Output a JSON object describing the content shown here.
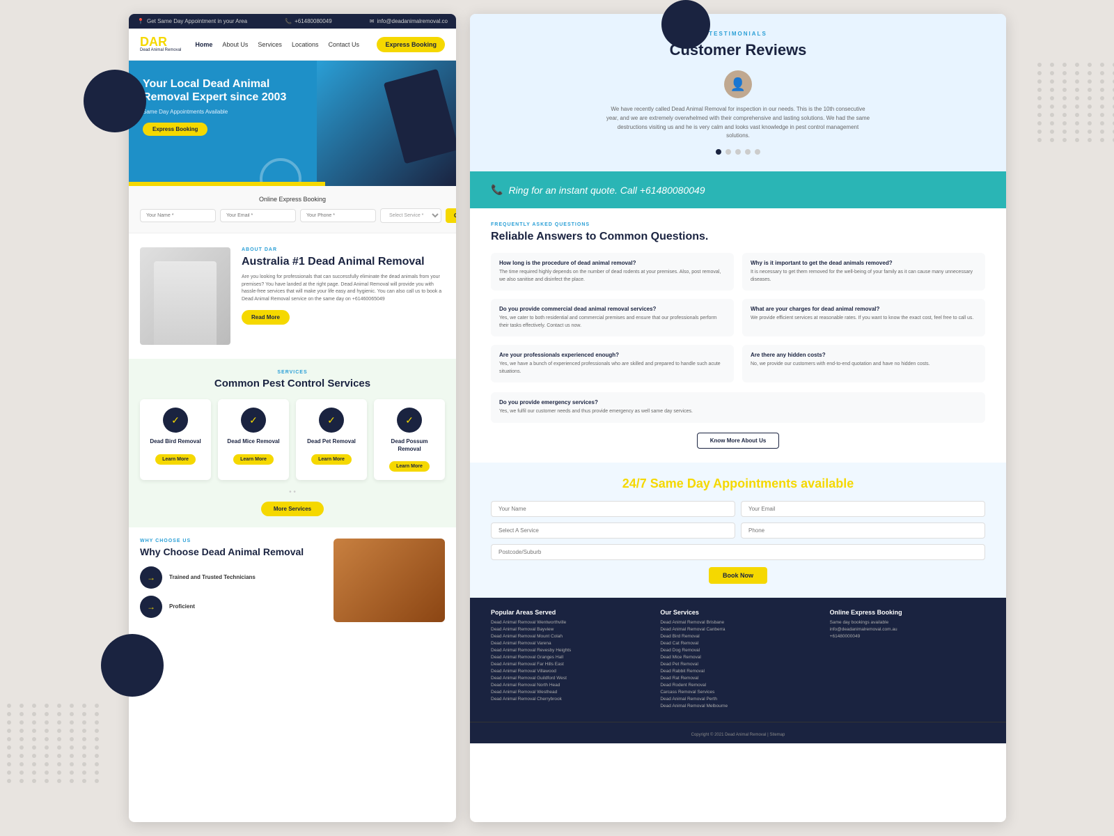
{
  "bg": {
    "decorative": "dot-pattern"
  },
  "left_panel": {
    "topbar": {
      "address": "Get Same Day Appointment in your Area",
      "phone": "+61480080049",
      "email": "info@deadanimalremoval.co"
    },
    "nav": {
      "logo_main": "DAR",
      "logo_sub": "Dead Animal Removal",
      "links": [
        {
          "label": "Home",
          "active": true
        },
        {
          "label": "About Us"
        },
        {
          "label": "Services"
        },
        {
          "label": "Locations"
        },
        {
          "label": "Contact Us"
        }
      ],
      "cta_button": "Express Booking"
    },
    "hero": {
      "title": "Your Local Dead Animal Removal Expert since 2003",
      "subtitle": "Same Day Appointments Available",
      "button": "Express Booking"
    },
    "booking_form": {
      "title": "Online Express Booking",
      "name_placeholder": "Your Name *",
      "email_placeholder": "Your Email *",
      "phone_placeholder": "Your Phone *",
      "service_placeholder": "Select Service *",
      "submit_label": "Get Started"
    },
    "about": {
      "label": "ABOUT DAR",
      "title": "Australia #1 Dead Animal Removal",
      "text": "Are you looking for professionals that can successfully eliminate the dead animals from your premises? You have landed at the right page. Dead Animal Removal will provide you with hassle-free services that will make your life easy and hygienic. You can also call us to book a Dead Animal Removal service on the same day on +61460065049",
      "read_more": "Read More"
    },
    "services": {
      "label": "SERVICES",
      "title": "Common Pest Control Services",
      "items": [
        {
          "name": "Dead Bird Removal",
          "button": "Learn More"
        },
        {
          "name": "Dead Mice Removal",
          "button": "Learn More"
        },
        {
          "name": "Dead Pet Removal",
          "button": "Learn More"
        },
        {
          "name": "Dead Possum Removal",
          "button": "Learn More"
        }
      ],
      "more_button": "More Services"
    },
    "why_choose": {
      "label": "WHY CHOOSE US",
      "title": "Why Choose Dead Animal Removal",
      "items": [
        {
          "text": "Trained and Trusted Technicians"
        },
        {
          "text": "Proficient"
        }
      ]
    }
  },
  "right_panel": {
    "testimonials": {
      "label": "TESTIMONIALS",
      "title": "Customer Reviews",
      "review_text": "We have recently called Dead Animal Removal for inspection in our needs. This is the 10th consecutive year, and we are extremely overwhelmed with their comprehensive and lasting solutions. We had the same destructions visiting us and he is very calm and looks vast knowledge in pest control management solutions.",
      "dots": [
        {
          "active": true
        },
        {
          "active": false
        },
        {
          "active": false
        },
        {
          "active": false
        },
        {
          "active": false
        }
      ]
    },
    "cta_bar": {
      "icon": "📞",
      "text": "Ring for an instant quote. Call +61480080049"
    },
    "faq": {
      "label": "FREQUENTLY ASKED QUESTIONS",
      "title": "Reliable Answers to Common Questions.",
      "items": [
        {
          "question": "How long is the procedure of dead animal removal?",
          "answer": "The time required highly depends on the number of dead rodents at your premises. Also, post removal, we also sanitise and disinfect the place."
        },
        {
          "question": "Why is it important to get the dead animals removed?",
          "answer": "It is necessary to get them removed for the well-being of your family as it can cause many unnecessary diseases."
        },
        {
          "question": "Do you provide commercial dead animal removal services?",
          "answer": "Yes, we cater to both residential and commercial premises and ensure that our professionals perform their tasks effectively. Contact us now."
        },
        {
          "question": "What are your charges for dead animal removal?",
          "answer": "We provide efficient services at reasonable rates. If you want to know the exact cost, feel free to call us."
        },
        {
          "question": "Are your professionals experienced enough?",
          "answer": "Yes, we have a bunch of experienced professionals who are skilled and prepared to handle such acute situations."
        },
        {
          "question": "Are there any hidden costs?",
          "answer": "No, we provide our customers with end-to-end quotation and have no hidden costs."
        }
      ],
      "single_item": {
        "question": "Do you provide emergency services?",
        "answer": "Yes, we fulfil our customer needs and thus provide emergency as well same day services."
      },
      "know_more_button": "Know More About Us"
    },
    "appointments": {
      "title_prefix": "24/7 Same Day ",
      "title_highlight": "Appointments",
      "title_suffix": " available",
      "form": {
        "name_placeholder": "Your Name",
        "email_placeholder": "Your Email",
        "service_placeholder": "Select A Service",
        "phone_placeholder": "Phone",
        "postcode_placeholder": "Postcode/Suburb"
      },
      "submit_label": "Book Now"
    },
    "footer": {
      "columns": [
        {
          "title": "Popular Areas Served",
          "links": [
            "Dead Animal Removal Wentworthville",
            "Dead Animal Removal Bayview",
            "Dead Animal Removal Mount Colah",
            "Dead Animal Removal Varena",
            "Dead Animal Removal Revesby Heights",
            "Dead Animal Removal Granges Hall",
            "Dead Animal Removal Far Hills East",
            "Dead Animal Removal Villawood",
            "Dead Animal Removal Guildford West",
            "Dead Animal Removal North Head",
            "Dead Animal Removal Westhead",
            "Dead Animal Removal Cherrybrook"
          ]
        },
        {
          "title": "Our Services",
          "links": [
            "Dead Animal Removal Brisbane",
            "Dead Animal Removal Canberra",
            "Dead Bird Removal",
            "Dead Cat Removal",
            "Dead Dog Removal",
            "Dead Mice Removal",
            "Dead Pet Removal",
            "Dead Rabbit Removal",
            "Dead Rat Removal",
            "Dead Rodent Removal",
            "Carcass Removal Services",
            "Dead Animal Removal Perth",
            "Dead Animal Removal Melbourne"
          ]
        },
        {
          "title": "Online Express Booking",
          "same_day": "Same day bookings available",
          "email": "info@deadanimalremoval.com.au",
          "phone": "+61480000049"
        }
      ],
      "copyright": "Copyright © 2021 Dead Animal Removal | Sitemap"
    }
  }
}
